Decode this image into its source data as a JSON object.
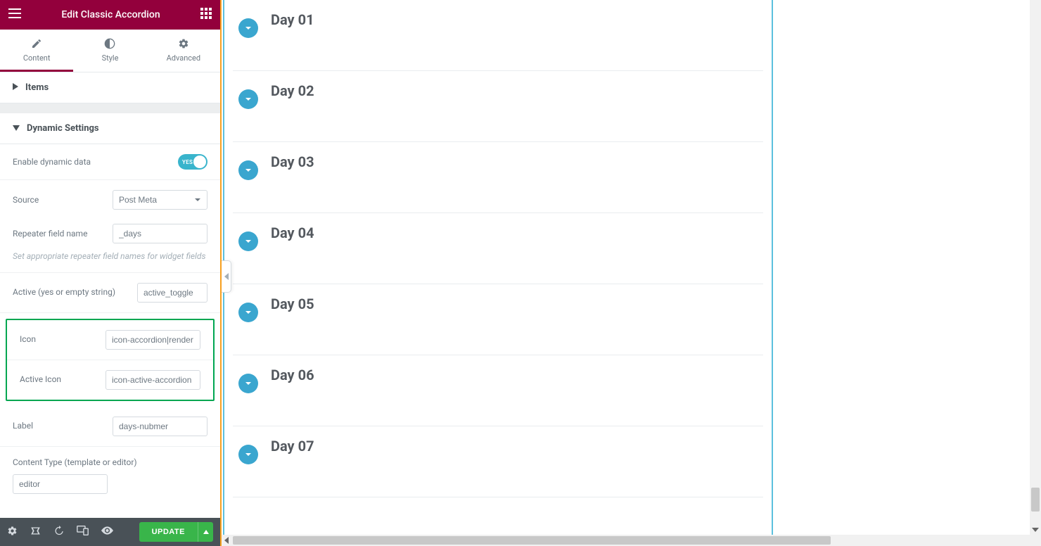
{
  "header": {
    "title": "Edit Classic Accordion"
  },
  "tabs": {
    "content": "Content",
    "style": "Style",
    "advanced": "Advanced",
    "active": "content"
  },
  "sections": {
    "items": "Items",
    "dynamic": "Dynamic Settings"
  },
  "controls": {
    "enable_dynamic": {
      "label": "Enable dynamic data",
      "switch_label": "YES"
    },
    "source": {
      "label": "Source",
      "value": "Post Meta"
    },
    "repeater": {
      "label": "Repeater field name",
      "value": "_days"
    },
    "hint": "Set appropriate repeater field names for widget fields",
    "active_field": {
      "label": "Active (yes or empty string)",
      "value": "active_toggle"
    },
    "icon": {
      "label": "Icon",
      "value": "icon-accordion|render"
    },
    "active_icon": {
      "label": "Active Icon",
      "value": "icon-active-accordion"
    },
    "label_field": {
      "label": "Label",
      "value": "days-nubmer"
    },
    "content_type": {
      "label": "Content Type (template or editor)",
      "value": "editor"
    }
  },
  "footer": {
    "update": "UPDATE"
  },
  "preview_items": [
    "Day 01",
    "Day 02",
    "Day 03",
    "Day 04",
    "Day 05",
    "Day 06",
    "Day 07"
  ]
}
